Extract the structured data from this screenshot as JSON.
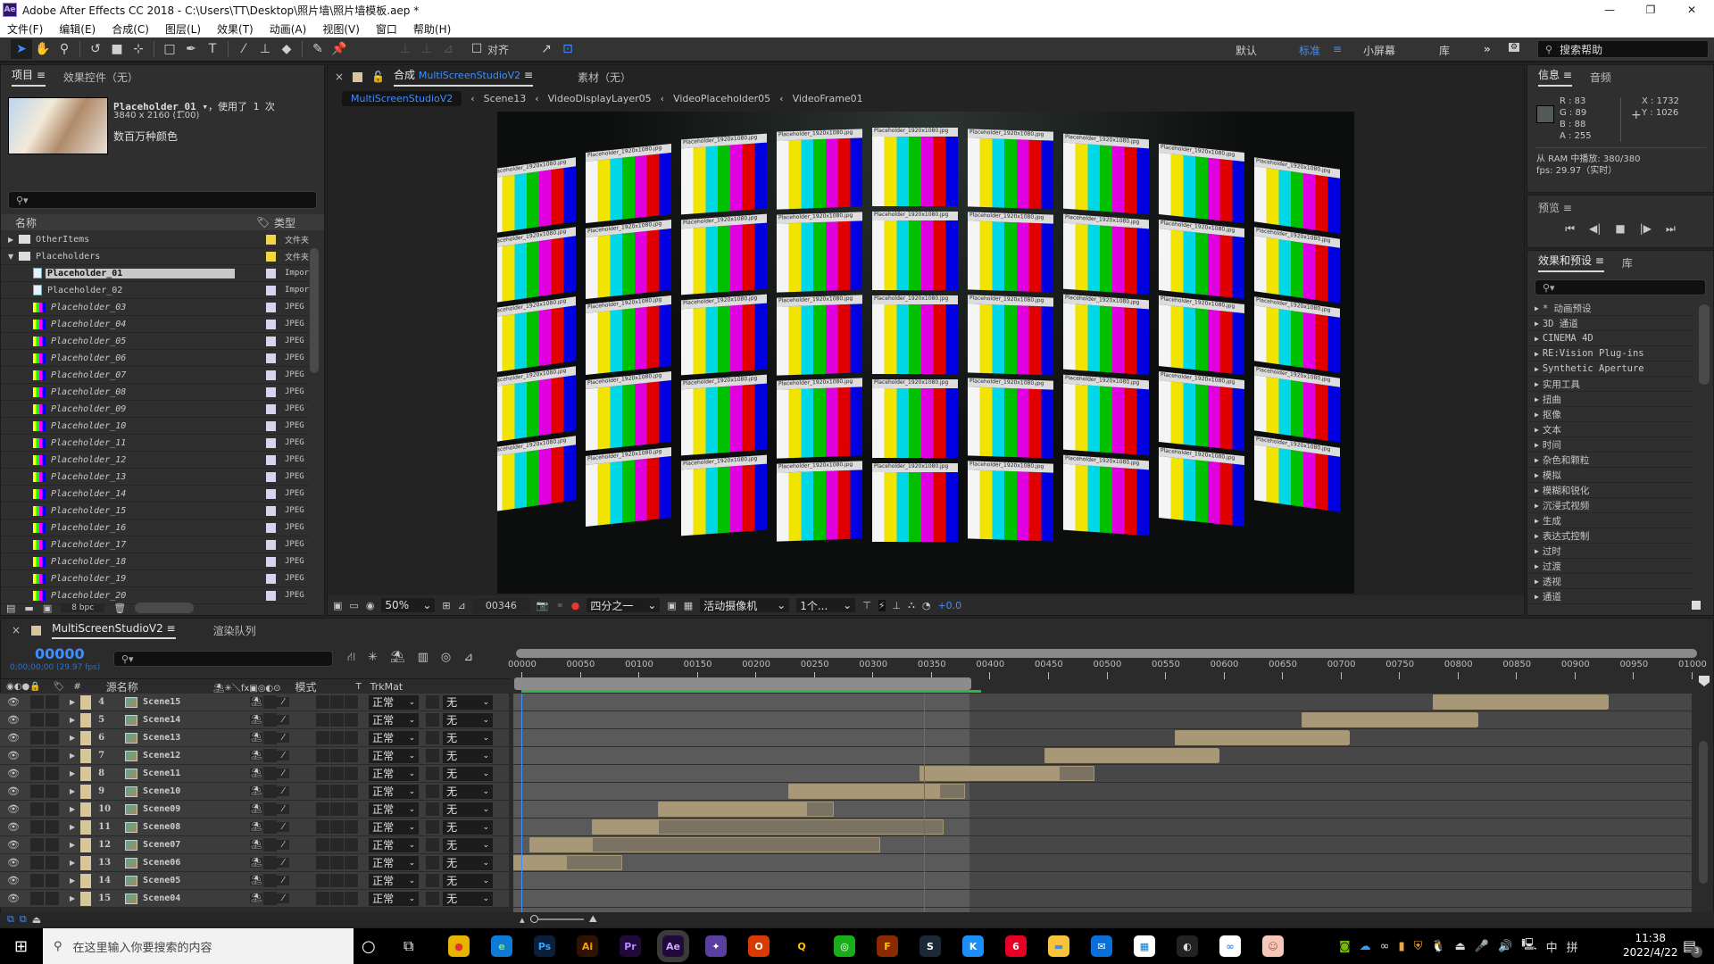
{
  "window": {
    "app_icon": "Ae",
    "title": "Adobe After Effects CC 2018 - C:\\Users\\TT\\Desktop\\照片墙\\照片墙模板.aep *",
    "minimize": "—",
    "maximize": "❐",
    "close": "✕"
  },
  "menu": [
    "文件(F)",
    "编辑(E)",
    "合成(C)",
    "图层(L)",
    "效果(T)",
    "动画(A)",
    "视图(V)",
    "窗口",
    "帮助(H)"
  ],
  "toolbar": {
    "tools": [
      "selection-tool",
      "hand-tool",
      "zoom-tool",
      "rotate-tool",
      "camera-tool",
      "pan-behind-tool",
      "rectangle-tool",
      "pen-tool",
      "type-tool",
      "brush-tool",
      "clone-stamp-tool",
      "eraser-tool",
      "roto-brush-tool",
      "puppet-pin-tool"
    ],
    "align_label": "对齐",
    "workspaces": [
      "默认",
      "标准",
      "小屏幕",
      "库"
    ],
    "active_workspace": "标准",
    "more": "»",
    "search_placeholder": "搜索帮助"
  },
  "project_panel": {
    "tabs": [
      "项目",
      "效果控件（无）"
    ],
    "selected_item": {
      "name": "Placeholder_01",
      "usage": "，使用了 1 次",
      "dimensions": "3840 x 2160 (1.00)",
      "color_info": "数百万种颜色"
    },
    "search_placeholder": "",
    "columns": {
      "name": "名称",
      "type": "类型"
    },
    "items": [
      {
        "name": "OtherItems",
        "type": "文件夹",
        "kind": "folder",
        "expanded": false,
        "label_color": "#f2d34a",
        "indent": 0
      },
      {
        "name": "Placeholders",
        "type": "文件夹",
        "kind": "folder",
        "expanded": true,
        "label_color": "#f2d34a",
        "indent": 0
      },
      {
        "name": "Placeholder_01",
        "type": "Import",
        "kind": "image",
        "label_color": "#d7d4ee",
        "indent": 1,
        "selected": true
      },
      {
        "name": "Placeholder_02",
        "type": "Import",
        "kind": "image",
        "label_color": "#d7d4ee",
        "indent": 1
      },
      {
        "name": "Placeholder_03",
        "type": "JPEG",
        "kind": "bars",
        "label_color": "#d7d4ee",
        "indent": 1
      },
      {
        "name": "Placeholder_04",
        "type": "JPEG",
        "kind": "bars",
        "label_color": "#d7d4ee",
        "indent": 1
      },
      {
        "name": "Placeholder_05",
        "type": "JPEG",
        "kind": "bars",
        "label_color": "#d7d4ee",
        "indent": 1
      },
      {
        "name": "Placeholder_06",
        "type": "JPEG",
        "kind": "bars",
        "label_color": "#d7d4ee",
        "indent": 1
      },
      {
        "name": "Placeholder_07",
        "type": "JPEG",
        "kind": "bars",
        "label_color": "#d7d4ee",
        "indent": 1
      },
      {
        "name": "Placeholder_08",
        "type": "JPEG",
        "kind": "bars",
        "label_color": "#d7d4ee",
        "indent": 1
      },
      {
        "name": "Placeholder_09",
        "type": "JPEG",
        "kind": "bars",
        "label_color": "#d7d4ee",
        "indent": 1
      },
      {
        "name": "Placeholder_10",
        "type": "JPEG",
        "kind": "bars",
        "label_color": "#d7d4ee",
        "indent": 1
      },
      {
        "name": "Placeholder_11",
        "type": "JPEG",
        "kind": "bars",
        "label_color": "#d7d4ee",
        "indent": 1
      },
      {
        "name": "Placeholder_12",
        "type": "JPEG",
        "kind": "bars",
        "label_color": "#d7d4ee",
        "indent": 1
      },
      {
        "name": "Placeholder_13",
        "type": "JPEG",
        "kind": "bars",
        "label_color": "#d7d4ee",
        "indent": 1
      },
      {
        "name": "Placeholder_14",
        "type": "JPEG",
        "kind": "bars",
        "label_color": "#d7d4ee",
        "indent": 1
      },
      {
        "name": "Placeholder_15",
        "type": "JPEG",
        "kind": "bars",
        "label_color": "#d7d4ee",
        "indent": 1
      },
      {
        "name": "Placeholder_16",
        "type": "JPEG",
        "kind": "bars",
        "label_color": "#d7d4ee",
        "indent": 1
      },
      {
        "name": "Placeholder_17",
        "type": "JPEG",
        "kind": "bars",
        "label_color": "#d7d4ee",
        "indent": 1
      },
      {
        "name": "Placeholder_18",
        "type": "JPEG",
        "kind": "bars",
        "label_color": "#d7d4ee",
        "indent": 1
      },
      {
        "name": "Placeholder_19",
        "type": "JPEG",
        "kind": "bars",
        "label_color": "#d7d4ee",
        "indent": 1
      },
      {
        "name": "Placeholder_20",
        "type": "JPEG",
        "kind": "bars",
        "label_color": "#d7d4ee",
        "indent": 1
      }
    ],
    "footer": {
      "bpc": "8 bpc"
    }
  },
  "composition_panel": {
    "tab_prefix": "合成",
    "tab_name": "MultiScreenStudioV2",
    "footage_tab": "素材（无）",
    "breadcrumbs": [
      "MultiScreenStudioV2",
      "Scene13",
      "VideoDisplayLayer05",
      "VideoPlaceholder05",
      "VideoFrame01"
    ],
    "viewer_footer": {
      "zoom": "50%",
      "timecode": "00346",
      "resolution": "四分之一",
      "camera": "活动摄像机",
      "views": "1个...",
      "exposure": "+0.0"
    },
    "tile_label": "Placeholder_1920x1080.jpg"
  },
  "info_panel": {
    "tabs": [
      "信息",
      "音频"
    ],
    "r": "R : 83",
    "g": "G : 89",
    "b": "B : 88",
    "a": "A : 255",
    "swatch_color": "#535958",
    "x": "X : 1732",
    "y": "Y : 1026",
    "ram_preview": "从 RAM 中播放: 380/380",
    "fps": "fps: 29.97（实时）"
  },
  "preview_panel": {
    "title": "预览",
    "controls": [
      "first-frame",
      "prev-frame",
      "stop",
      "play",
      "last-frame"
    ]
  },
  "effects_panel": {
    "tabs": [
      "效果和预设",
      "库"
    ],
    "categories": [
      "* 动画预设",
      "3D 通道",
      "CINEMA 4D",
      "RE:Vision Plug-ins",
      "Synthetic Aperture",
      "实用工具",
      "扭曲",
      "抠像",
      "文本",
      "时间",
      "杂色和颗粒",
      "模拟",
      "模糊和锐化",
      "沉浸式视频",
      "生成",
      "表达式控制",
      "过时",
      "过渡",
      "透视",
      "通道"
    ]
  },
  "timeline": {
    "tab_name": "MultiScreenStudioV2",
    "render_queue_tab": "渲染队列",
    "current_frame": "00000",
    "current_timecode": "0;00;00;00 (29.97 fps)",
    "columns": {
      "source_name": "源名称",
      "mode": "模式",
      "t": "T",
      "trkmat": "TrkMat",
      "num": "#"
    },
    "ruler": [
      "00000",
      "00050",
      "00100",
      "00150",
      "00200",
      "00250",
      "00300",
      "00350",
      "00400",
      "00450",
      "00500",
      "00550",
      "00600",
      "00650",
      "00700",
      "00750",
      "00800",
      "00850",
      "00900",
      "00950",
      "01000"
    ],
    "ruler_range": [
      0,
      1000
    ],
    "work_area_end": 383,
    "cti_frame": 344,
    "layers": [
      {
        "index": "4",
        "name": "Scene15",
        "mode": "正常",
        "trkmat": "无",
        "in": 779,
        "solid_end": 928,
        "out": 928
      },
      {
        "index": "5",
        "name": "Scene14",
        "mode": "正常",
        "trkmat": "无",
        "in": 667,
        "solid_end": 817,
        "out": 817
      },
      {
        "index": "6",
        "name": "Scene13",
        "mode": "正常",
        "trkmat": "无",
        "in": 558,
        "solid_end": 707,
        "out": 707
      },
      {
        "index": "7",
        "name": "Scene12",
        "mode": "正常",
        "trkmat": "无",
        "in": 447,
        "solid_end": 596,
        "out": 596
      },
      {
        "index": "8",
        "name": "Scene11",
        "mode": "正常",
        "trkmat": "无",
        "in": 340,
        "solid_end": 459,
        "out": 490
      },
      {
        "index": "9",
        "name": "Scene10",
        "mode": "正常",
        "trkmat": "无",
        "in": 228,
        "solid_end": 357,
        "out": 379
      },
      {
        "index": "10",
        "name": "Scene09",
        "mode": "正常",
        "trkmat": "无",
        "in": 117,
        "solid_end": 243,
        "out": 267
      },
      {
        "index": "11",
        "name": "Scene08",
        "mode": "正常",
        "trkmat": "无",
        "in": 60,
        "solid_end": 117,
        "out": 361
      },
      {
        "index": "12",
        "name": "Scene07",
        "mode": "正常",
        "trkmat": "无",
        "in": 7,
        "solid_end": 60,
        "out": 307
      },
      {
        "index": "13",
        "name": "Scene06",
        "mode": "正常",
        "trkmat": "无",
        "in": -8,
        "solid_end": 38,
        "out": 86
      },
      {
        "index": "14",
        "name": "Scene05",
        "mode": "正常",
        "trkmat": "无"
      },
      {
        "index": "15",
        "name": "Scene04",
        "mode": "正常",
        "trkmat": "无"
      }
    ],
    "layer_label_color": "#d9c59a"
  },
  "taskbar": {
    "search_placeholder": "在这里输入你要搜索的内容",
    "apps": [
      {
        "name": "chrome",
        "label": "●",
        "bg": "#e8b400",
        "fg": "#d33"
      },
      {
        "name": "edge",
        "label": "e",
        "bg": "#0f7bd6",
        "fg": "#7fe07f"
      },
      {
        "name": "photoshop",
        "label": "Ps",
        "bg": "#0b1f3a",
        "fg": "#31a8ff"
      },
      {
        "name": "illustrator",
        "label": "Ai",
        "bg": "#2e1300",
        "fg": "#ff9a00"
      },
      {
        "name": "premiere",
        "label": "Pr",
        "bg": "#1f0a3a",
        "fg": "#b68cff"
      },
      {
        "name": "after-effects",
        "label": "Ae",
        "bg": "#1f0a3a",
        "fg": "#c9a8ff"
      },
      {
        "name": "app-star",
        "label": "✦",
        "bg": "#5a3fa0",
        "fg": "#fff"
      },
      {
        "name": "office",
        "label": "O",
        "bg": "#d83b01",
        "fg": "#fff"
      },
      {
        "name": "qq",
        "label": "Q",
        "bg": "#000",
        "fg": "#ffc000"
      },
      {
        "name": "wechat",
        "label": "◎",
        "bg": "#1aad19",
        "fg": "#fff"
      },
      {
        "name": "game-cf",
        "label": "F",
        "bg": "#8b2a00",
        "fg": "#ffc400"
      },
      {
        "name": "steam",
        "label": "S",
        "bg": "#1b2838",
        "fg": "#fff"
      },
      {
        "name": "kugou",
        "label": "K",
        "bg": "#1b8ef8",
        "fg": "#fff"
      },
      {
        "name": "netease-music",
        "label": "6",
        "bg": "#e60026",
        "fg": "#fff"
      },
      {
        "name": "file-explorer",
        "label": "▬",
        "bg": "#f8c33a",
        "fg": "#4a90d9"
      },
      {
        "name": "mail",
        "label": "✉",
        "bg": "#0a6fd6",
        "fg": "#fff"
      },
      {
        "name": "store",
        "label": "▦",
        "bg": "#fff",
        "fg": "#0078d4"
      },
      {
        "name": "obs",
        "label": "◐",
        "bg": "#222",
        "fg": "#ddd"
      },
      {
        "name": "baidu-netdisk",
        "label": "∞",
        "bg": "#fff",
        "fg": "#3b8cff"
      },
      {
        "name": "avatar-app",
        "label": "☺",
        "bg": "#f4c7b8",
        "fg": "#a05a50"
      }
    ],
    "time": "11:38",
    "date": "2022/4/22",
    "ime": "中",
    "ime2": "拼",
    "notifications": "3"
  }
}
